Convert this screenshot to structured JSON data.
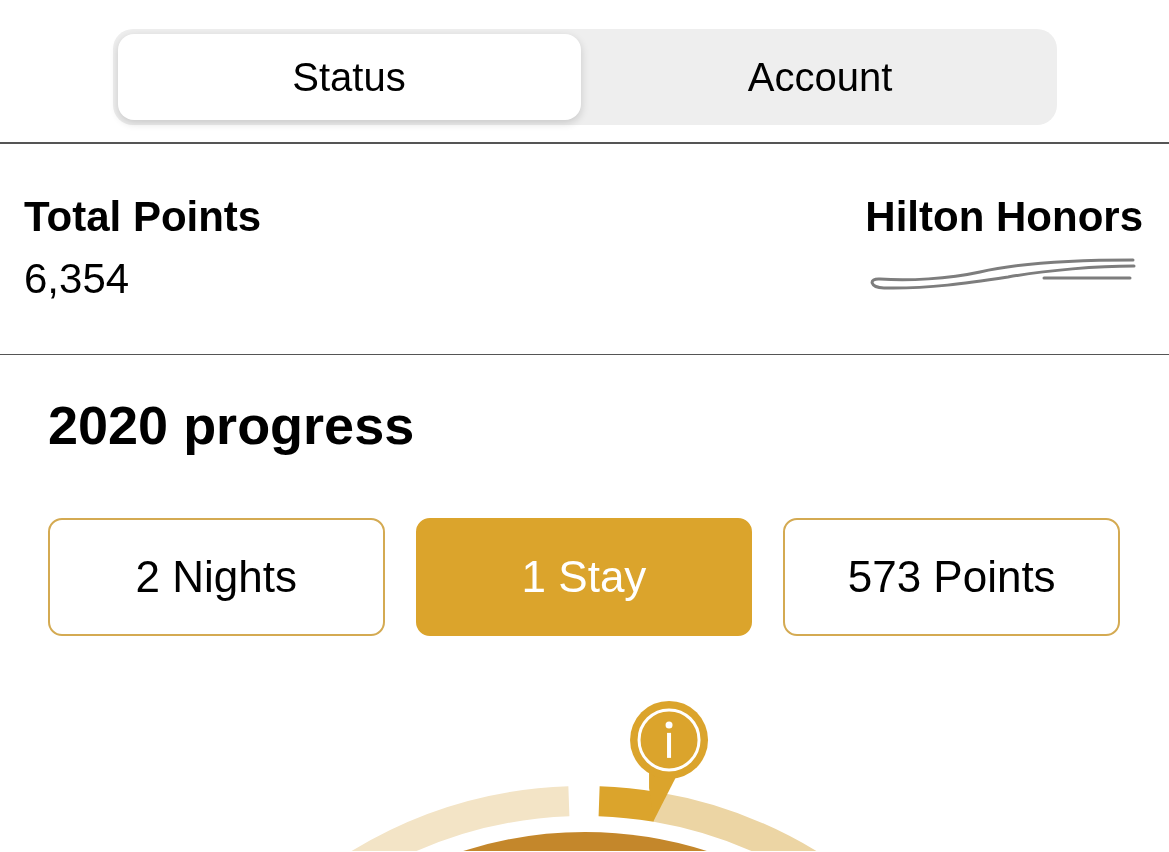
{
  "segmented_control": {
    "tabs": [
      {
        "label": "Status",
        "selected": true
      },
      {
        "label": "Account",
        "selected": false
      }
    ]
  },
  "summary": {
    "total_points": {
      "label": "Total Points",
      "value": "6,354"
    },
    "program": {
      "name": "Hilton Honors"
    }
  },
  "progress": {
    "title": "2020 progress",
    "tabs": [
      {
        "label": "2 Nights",
        "selected": false
      },
      {
        "label": "1 Stay",
        "selected": true
      },
      {
        "label": "573 Points",
        "selected": false
      }
    ]
  }
}
